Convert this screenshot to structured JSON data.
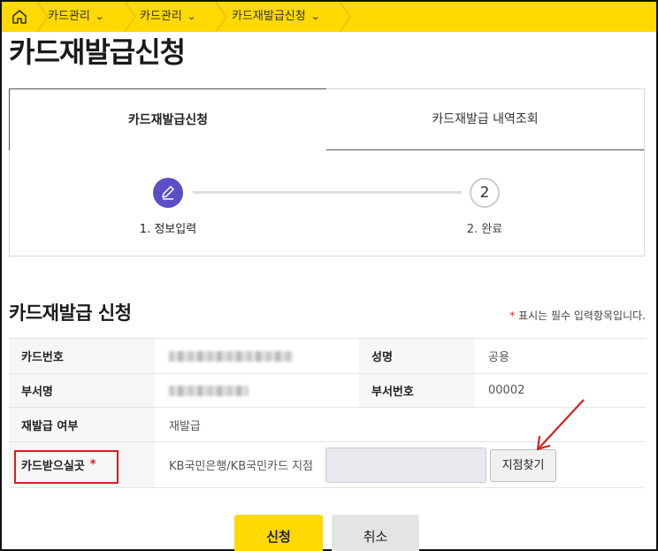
{
  "breadcrumb": {
    "items": [
      {
        "label": "카드관리"
      },
      {
        "label": "카드관리"
      },
      {
        "label": "카드재발급신청"
      }
    ]
  },
  "page": {
    "title": "카드재발급신청"
  },
  "tabs": [
    {
      "label": "카드재발급신청",
      "active": true
    },
    {
      "label": "카드재발급 내역조회",
      "active": false
    }
  ],
  "steps": [
    {
      "label": "1. 정보입력",
      "number": "1",
      "current": true
    },
    {
      "label": "2. 완료",
      "number": "2",
      "current": false
    }
  ],
  "form": {
    "title": "카드재발급 신청",
    "required_star": "*",
    "required_note": "표시는 필수 입력항목입니다.",
    "card_number_label": "카드번호",
    "name_label": "성명",
    "name_value": "공용",
    "department_label": "부서명",
    "department_number_label": "부서번호",
    "department_number_value": "00002",
    "reissue_label": "재발급 여부",
    "reissue_value": "재발급",
    "pickup_label": "카드받으실곳",
    "pickup_star": "*",
    "pickup_prefix": "KB국민은행/KB국민카드 지점",
    "pickup_input_value": "",
    "branch_button": "지점찾기"
  },
  "actions": {
    "apply": "신청",
    "cancel": "취소"
  },
  "colors": {
    "accent": "#ffd900",
    "step_active": "#5a4fc4",
    "highlight": "#d42020"
  }
}
